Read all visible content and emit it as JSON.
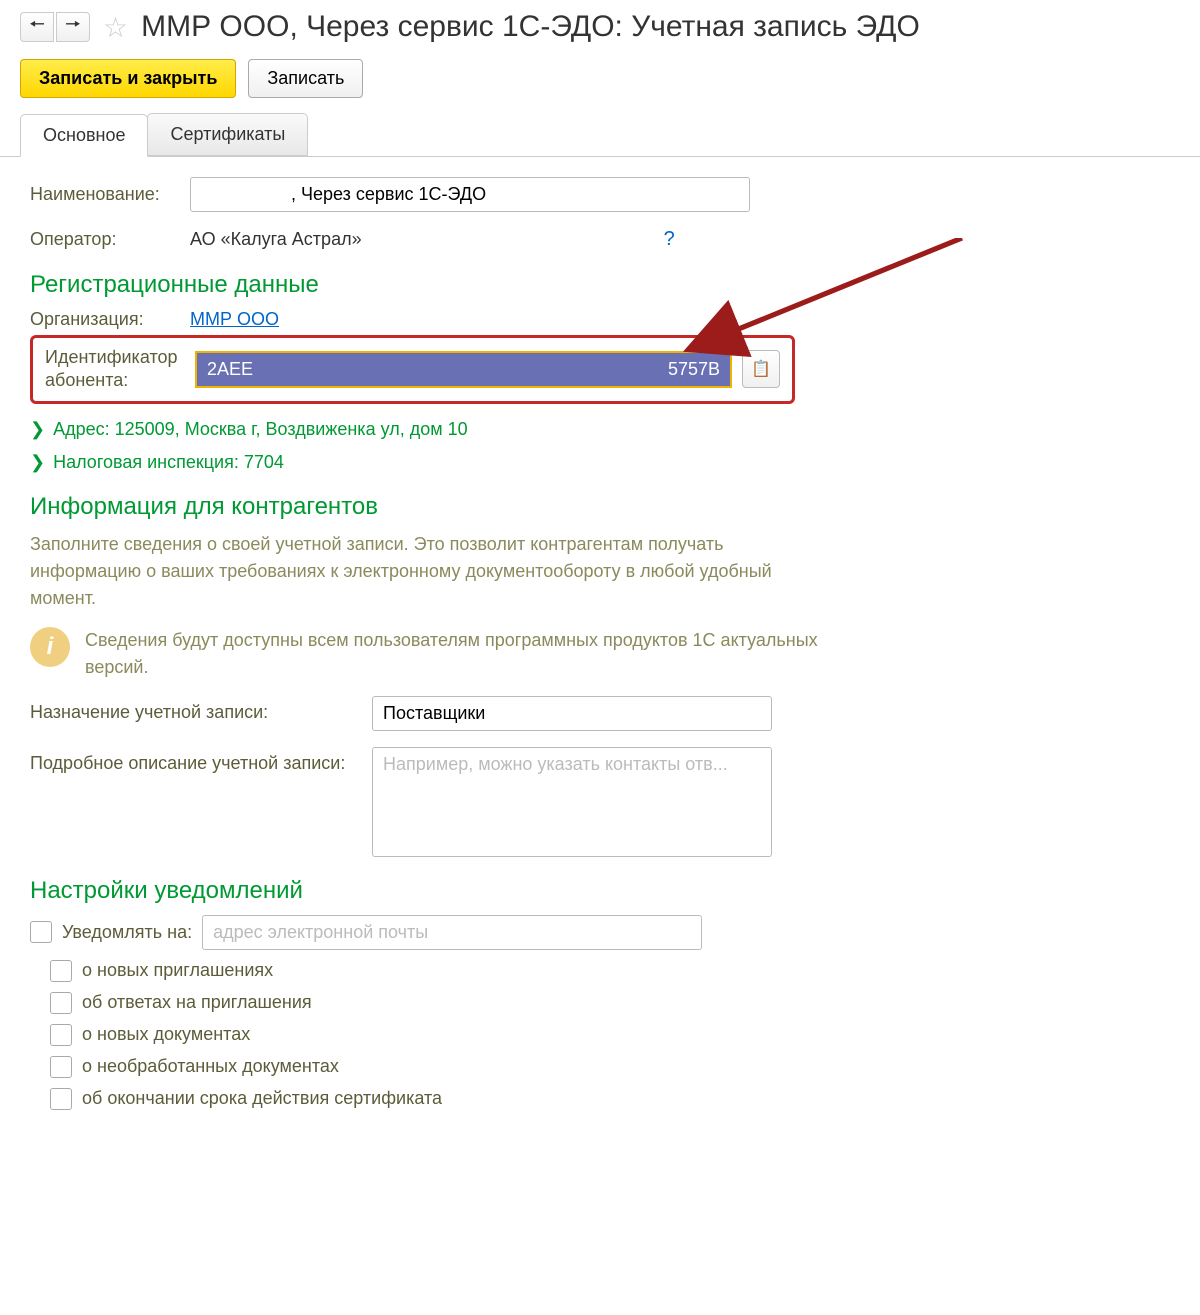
{
  "header": {
    "title": "ММР ООО, Через сервис 1С-ЭДО: Учетная запись ЭДО"
  },
  "toolbar": {
    "save_close": "Записать и закрыть",
    "save": "Записать"
  },
  "tabs": {
    "main": "Основное",
    "certs": "Сертификаты"
  },
  "main": {
    "name_label": "Наименование:",
    "name_value": ", Через сервис 1С-ЭДО",
    "operator_label": "Оператор:",
    "operator_value": "АО «Калуга Астрал»",
    "help": "?"
  },
  "reg": {
    "title": "Регистрационные данные",
    "org_label": "Организация:",
    "org_value": "ММР ООО",
    "id_label": "Идентификатор абонента:",
    "id_left": "2AEE",
    "id_right": "5757B",
    "address": "Адрес: 125009, Москва г, Воздвиженка ул, дом 10",
    "tax": "Налоговая инспекция: 7704"
  },
  "info": {
    "title": "Информация для контрагентов",
    "desc": "Заполните сведения о своей учетной записи. Это позволит контрагентам получать информацию о ваших требованиях к электронному документообороту в любой удобный момент.",
    "note": "Сведения будут доступны всем пользователям программных продуктов 1С актуальных версий.",
    "purpose_label": "Назначение учетной записи:",
    "purpose_value": "Поставщики",
    "detail_label": "Подробное описание учетной записи:",
    "detail_placeholder": "Например, можно указать контакты отв..."
  },
  "notif": {
    "title": "Настройки уведомлений",
    "notify_label": "Уведомлять на:",
    "email_placeholder": "адрес электронной почты",
    "opt1": "о новых приглашениях",
    "opt2": "об ответах на приглашения",
    "opt3": "о новых документах",
    "opt4": "о необработанных документах",
    "opt5": "об окончании срока действия сертификата"
  }
}
